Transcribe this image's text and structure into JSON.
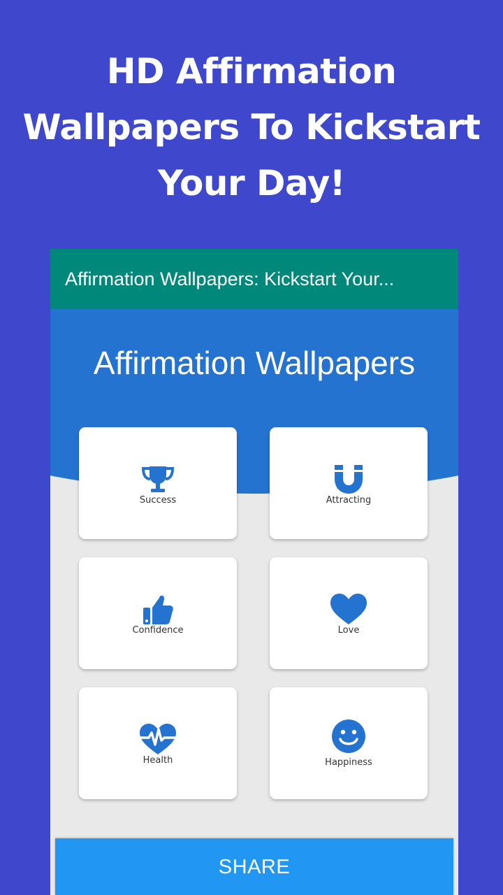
{
  "promo": {
    "title_line1": "HD Affirmation",
    "title_line2": "Wallpapers To Kickstart",
    "title_line3": "Your Day!"
  },
  "appbar": {
    "title": "Affirmation Wallpapers: Kickstart Your..."
  },
  "header": {
    "title": "Affirmation Wallpapers"
  },
  "categories": [
    {
      "label": "Success",
      "icon": "trophy-icon"
    },
    {
      "label": "Attracting",
      "icon": "magnet-icon"
    },
    {
      "label": "Confidence",
      "icon": "thumbs-up-icon"
    },
    {
      "label": "Love",
      "icon": "heart-icon"
    },
    {
      "label": "Health",
      "icon": "heartbeat-icon"
    },
    {
      "label": "Happiness",
      "icon": "smiley-icon"
    }
  ],
  "share": {
    "label": "SHARE"
  },
  "colors": {
    "background": "#3f48cc",
    "appbar": "#00897b",
    "header": "#2573d1",
    "icon": "#2573d1",
    "share": "#2196f3"
  }
}
